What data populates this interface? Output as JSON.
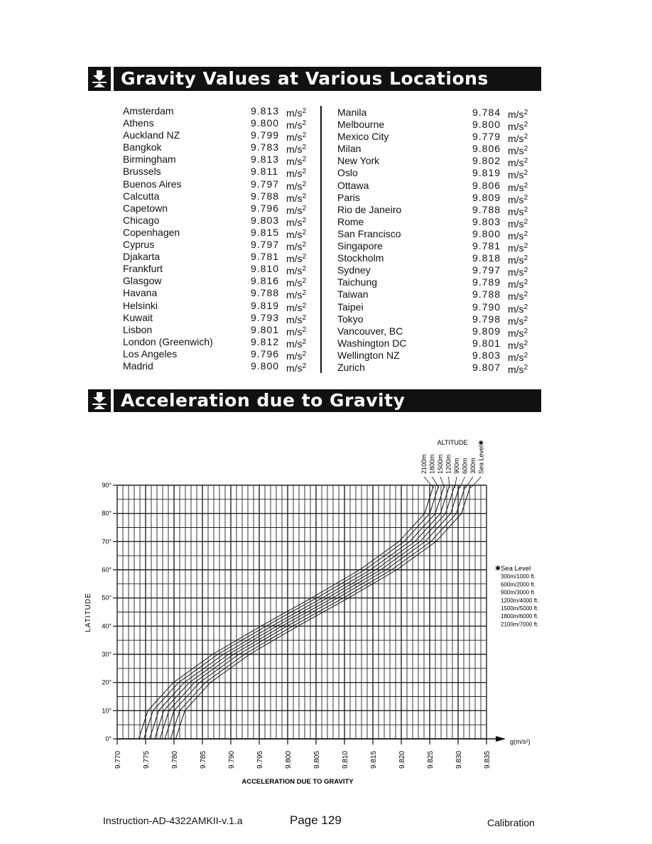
{
  "sections": {
    "gravity_values_title": "Gravity Values at Various Locations",
    "acceleration_title": "Acceleration due to Gravity"
  },
  "unit": "m/s",
  "unit_exp": "2",
  "locations_left": [
    {
      "city": "Amsterdam",
      "value": "9.813"
    },
    {
      "city": "Athens",
      "value": "9.800"
    },
    {
      "city": "Auckland NZ",
      "value": "9.799"
    },
    {
      "city": "Bangkok",
      "value": "9.783"
    },
    {
      "city": "Birmingham",
      "value": "9.813"
    },
    {
      "city": "Brussels",
      "value": "9.811"
    },
    {
      "city": "Buenos Aires",
      "value": "9.797"
    },
    {
      "city": "Calcutta",
      "value": "9.788"
    },
    {
      "city": "Capetown",
      "value": "9.796"
    },
    {
      "city": "Chicago",
      "value": "9.803"
    },
    {
      "city": "Copenhagen",
      "value": "9.815"
    },
    {
      "city": "Cyprus",
      "value": "9.797"
    },
    {
      "city": "Djakarta",
      "value": "9.781"
    },
    {
      "city": "Frankfurt",
      "value": "9.810"
    },
    {
      "city": "Glasgow",
      "value": "9.816"
    },
    {
      "city": "Havana",
      "value": "9.788"
    },
    {
      "city": "Helsinki",
      "value": "9.819"
    },
    {
      "city": "Kuwait",
      "value": "9.793"
    },
    {
      "city": "Lisbon",
      "value": "9.801"
    },
    {
      "city": "London (Greenwich)",
      "value": "9.812"
    },
    {
      "city": "Los Angeles",
      "value": "9.796"
    },
    {
      "city": "Madrid",
      "value": "9.800"
    }
  ],
  "locations_right": [
    {
      "city": "Manila",
      "value": "9.784"
    },
    {
      "city": "Melbourne",
      "value": "9.800"
    },
    {
      "city": "Mexico City",
      "value": "9.779"
    },
    {
      "city": "Milan",
      "value": "9.806"
    },
    {
      "city": "New York",
      "value": "9.802"
    },
    {
      "city": "Oslo",
      "value": "9.819"
    },
    {
      "city": "Ottawa",
      "value": "9.806"
    },
    {
      "city": "Paris",
      "value": "9.809"
    },
    {
      "city": "Rio de Janeiro",
      "value": "9.788"
    },
    {
      "city": "Rome",
      "value": "9.803"
    },
    {
      "city": "San Francisco",
      "value": "9.800"
    },
    {
      "city": "Singapore",
      "value": "9.781"
    },
    {
      "city": "Stockholm",
      "value": "9.818"
    },
    {
      "city": "Sydney",
      "value": "9.797"
    },
    {
      "city": "Taichung",
      "value": "9.789"
    },
    {
      "city": "Taiwan",
      "value": "9.788"
    },
    {
      "city": "Taipei",
      "value": "9.790"
    },
    {
      "city": "Tokyo",
      "value": "9.798"
    },
    {
      "city": "Vancouver, BC",
      "value": "9.809"
    },
    {
      "city": "Washington DC",
      "value": "9.801"
    },
    {
      "city": "Wellington NZ",
      "value": "9.803"
    },
    {
      "city": "Zurich",
      "value": "9.807"
    }
  ],
  "chart_data": {
    "type": "line",
    "title": "Acceleration due to Gravity",
    "xlabel": "ACCELERATION DUE TO GRAVITY",
    "x_axis_unit_label": "g(m/s²)",
    "ylabel": "LATITUDE",
    "xlim": [
      9.77,
      9.835
    ],
    "ylim": [
      0,
      90
    ],
    "grid": true,
    "x_ticks": [
      "9.770",
      "9.775",
      "9.780",
      "9.785",
      "9.790",
      "9.795",
      "9.800",
      "9.805",
      "9.810",
      "9.815",
      "9.820",
      "9.825",
      "9.830",
      "9.835"
    ],
    "y_ticks": [
      "0°",
      "10°",
      "20°",
      "30°",
      "40°",
      "50°",
      "60°",
      "70°",
      "80°",
      "90°"
    ],
    "altitude_header": "ALTITUDE",
    "altitude_labels": [
      "2100m",
      "1800m",
      "1500m",
      "1200m",
      "900m",
      "600m",
      "300m",
      "Sea Level✱"
    ],
    "legend": {
      "placement": "right",
      "entries": [
        "✱Sea Level",
        "300m/1000 ft.",
        "600m/2000 ft.",
        "900m/3000 ft.",
        "1200m/4000 ft.",
        "1500m/5000 ft.",
        "1800m/6000 ft.",
        "2100m/7000 ft."
      ]
    },
    "latitudes": [
      0,
      10,
      20,
      30,
      40,
      50,
      60,
      70,
      80,
      90
    ],
    "series": [
      {
        "name": "Sea Level",
        "altitude_m": 0,
        "g": [
          9.7803,
          9.7819,
          9.7864,
          9.7933,
          9.8018,
          9.8107,
          9.8192,
          9.8261,
          9.8306,
          9.8322
        ]
      },
      {
        "name": "300m",
        "altitude_m": 300,
        "g": [
          9.7794,
          9.781,
          9.7855,
          9.7924,
          9.8009,
          9.8098,
          9.8183,
          9.8252,
          9.8297,
          9.8313
        ]
      },
      {
        "name": "600m",
        "altitude_m": 600,
        "g": [
          9.7784,
          9.78,
          9.7845,
          9.7914,
          9.7999,
          9.8088,
          9.8173,
          9.8242,
          9.8287,
          9.8303
        ]
      },
      {
        "name": "900m",
        "altitude_m": 900,
        "g": [
          9.7775,
          9.7791,
          9.7836,
          9.7905,
          9.799,
          9.8079,
          9.8164,
          9.8233,
          9.8278,
          9.8294
        ]
      },
      {
        "name": "1200m",
        "altitude_m": 1200,
        "g": [
          9.7766,
          9.7782,
          9.7827,
          9.7896,
          9.7981,
          9.807,
          9.8155,
          9.8224,
          9.8269,
          9.8285
        ]
      },
      {
        "name": "1500m",
        "altitude_m": 1500,
        "g": [
          9.7757,
          9.7773,
          9.7818,
          9.7887,
          9.7972,
          9.8061,
          9.8146,
          9.8215,
          9.826,
          9.8276
        ]
      },
      {
        "name": "1800m",
        "altitude_m": 1800,
        "g": [
          9.7747,
          9.7763,
          9.7808,
          9.7877,
          9.7962,
          9.8051,
          9.8136,
          9.8205,
          9.825,
          9.8266
        ]
      },
      {
        "name": "2100m",
        "altitude_m": 2100,
        "g": [
          9.7738,
          9.7754,
          9.7799,
          9.7868,
          9.7953,
          9.8042,
          9.8127,
          9.8196,
          9.8241,
          9.8257
        ]
      }
    ]
  },
  "footer": {
    "doc_id": "Instruction-AD-4322AMKII-v.1.a",
    "page": "Page  129",
    "section": "Calibration"
  }
}
